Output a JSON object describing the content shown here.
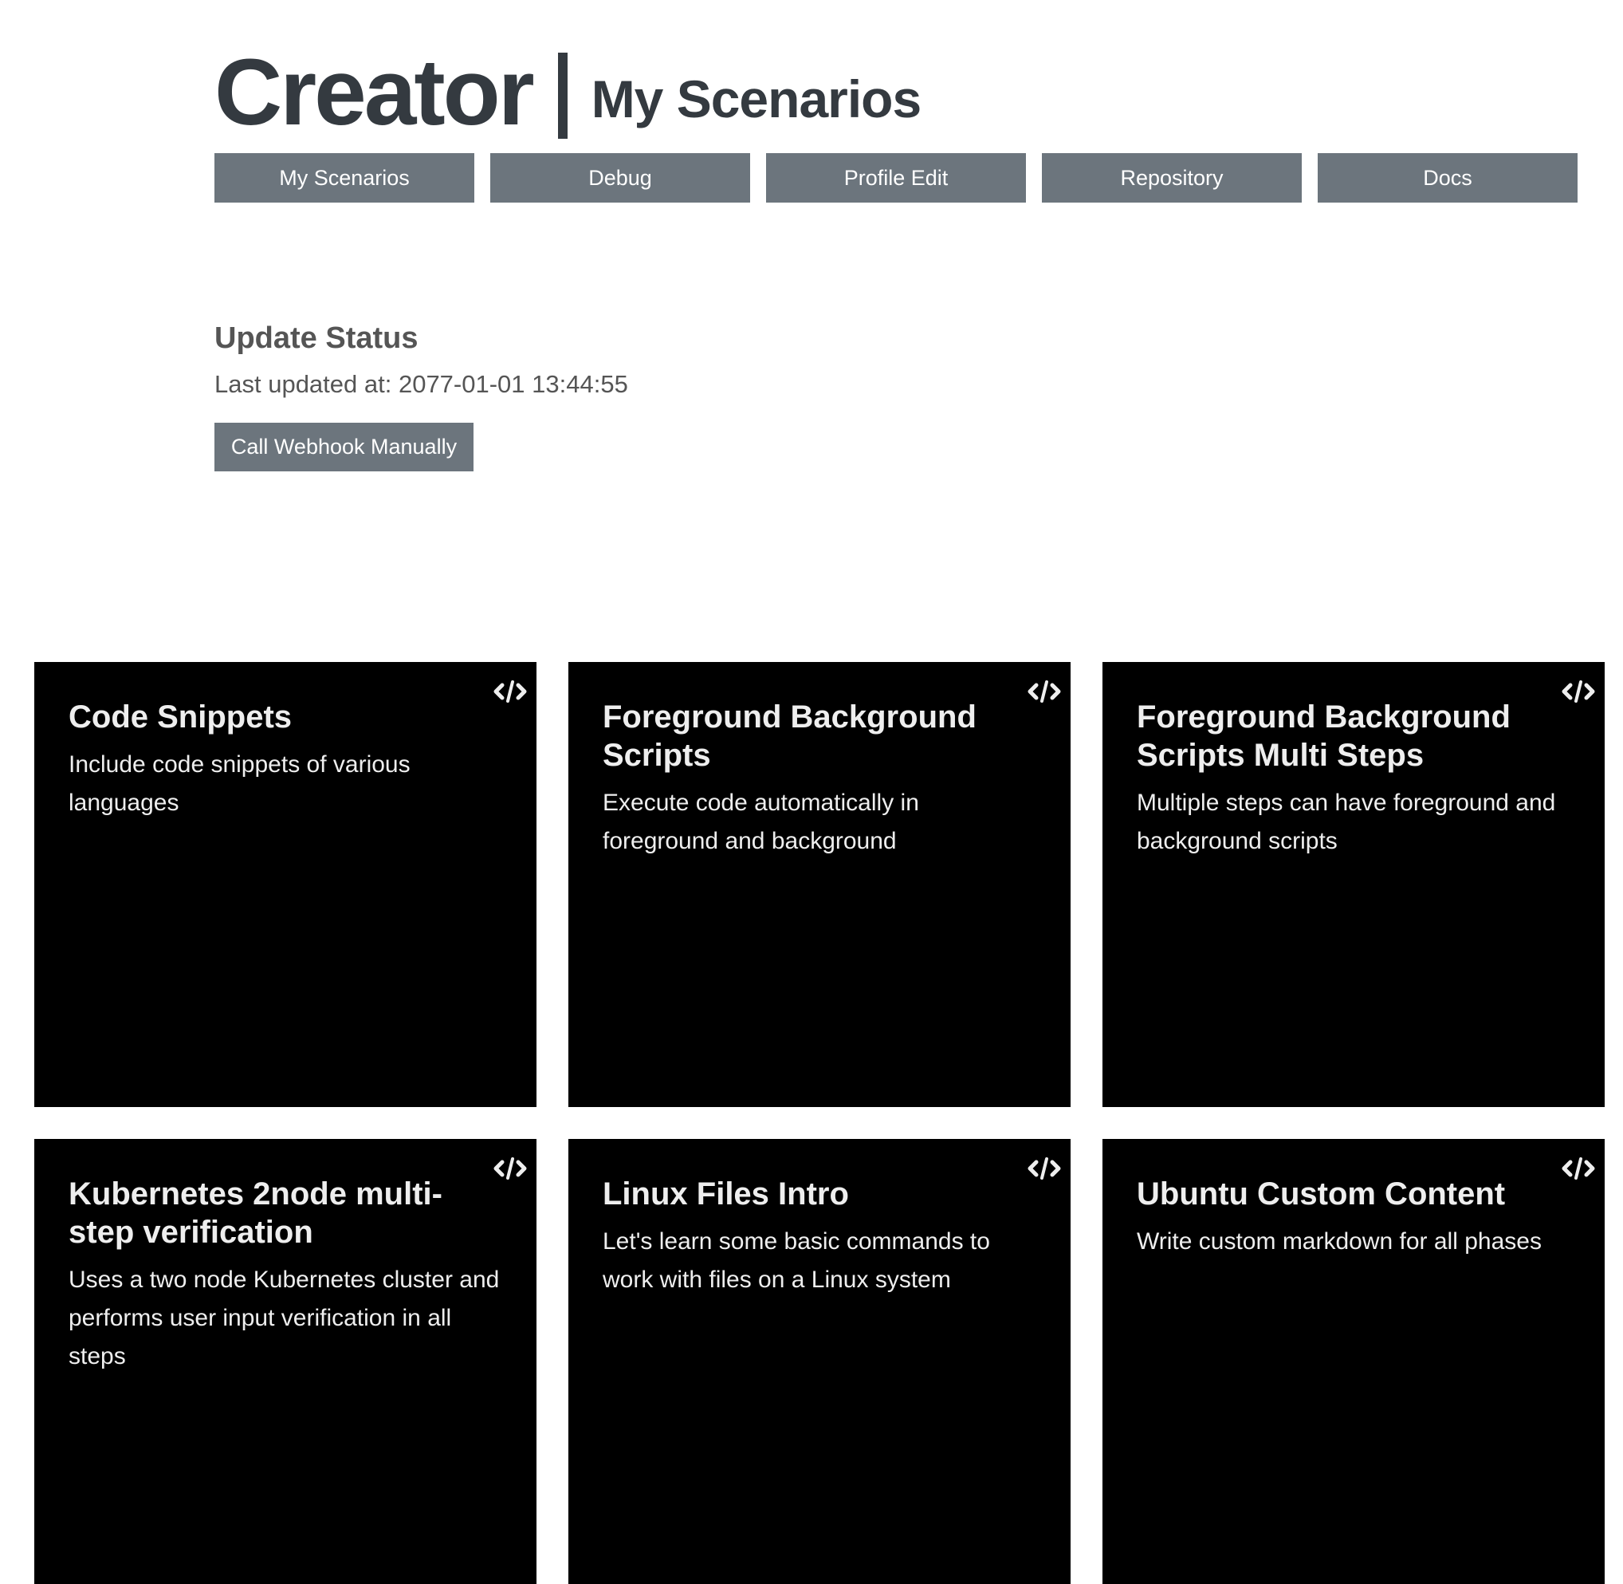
{
  "header": {
    "brand": "Creator",
    "page_title": "My Scenarios"
  },
  "nav": [
    {
      "label": "My Scenarios"
    },
    {
      "label": "Debug"
    },
    {
      "label": "Profile Edit"
    },
    {
      "label": "Repository"
    },
    {
      "label": "Docs"
    }
  ],
  "status": {
    "title": "Update Status",
    "last_updated": "Last updated at: 2077-01-01 13:44:55",
    "webhook_button": "Call Webhook Manually"
  },
  "colors": {
    "button_bg": "#6c757d",
    "heading": "#343a40",
    "card_bg": "#000000",
    "card_text": "#eeeeee"
  },
  "scenarios": [
    {
      "title": "Code Snippets",
      "description": "Include code snippets of various languages",
      "icon": "code-icon"
    },
    {
      "title": "Foreground Background Scripts",
      "description": "Execute code automatically in foreground and background",
      "icon": "code-icon"
    },
    {
      "title": "Foreground Background Scripts Multi Steps",
      "description": "Multiple steps can have foreground and background scripts",
      "icon": "code-icon"
    },
    {
      "title": "Kubernetes 2node multi-step verification",
      "description": "Uses a two node Kubernetes cluster and performs user input verification in all steps",
      "icon": "code-icon"
    },
    {
      "title": "Linux Files Intro",
      "description": "Let's learn some basic commands to work with files on a Linux system",
      "icon": "code-icon"
    },
    {
      "title": "Ubuntu Custom Content",
      "description": "Write custom markdown for all phases",
      "icon": "code-icon"
    }
  ]
}
